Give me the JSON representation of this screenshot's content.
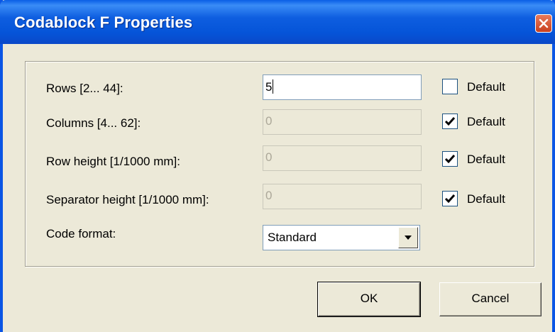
{
  "window": {
    "title": "Codablock F Properties"
  },
  "fields": [
    {
      "label": "Rows [2... 44]:",
      "value": "5",
      "enabled": true,
      "default_label": "Default",
      "default_checked": false
    },
    {
      "label": "Columns [4... 62]:",
      "value": "0",
      "enabled": false,
      "default_label": "Default",
      "default_checked": true
    },
    {
      "label": "Row height [1/1000 mm]:",
      "value": "0",
      "enabled": false,
      "default_label": "Default",
      "default_checked": true
    },
    {
      "label": "Separator height [1/1000 mm]:",
      "value": "0",
      "enabled": false,
      "default_label": "Default",
      "default_checked": true
    }
  ],
  "code_format": {
    "label": "Code format:",
    "selected": "Standard"
  },
  "buttons": {
    "ok": "OK",
    "cancel": "Cancel"
  },
  "colors": {
    "titlebar": "#0554d8",
    "dialog_bg": "#ece9d8",
    "close": "#d8542b"
  },
  "icons": {
    "close": "close-icon",
    "check": "checkmark-icon",
    "dropdown": "chevron-down-icon"
  }
}
